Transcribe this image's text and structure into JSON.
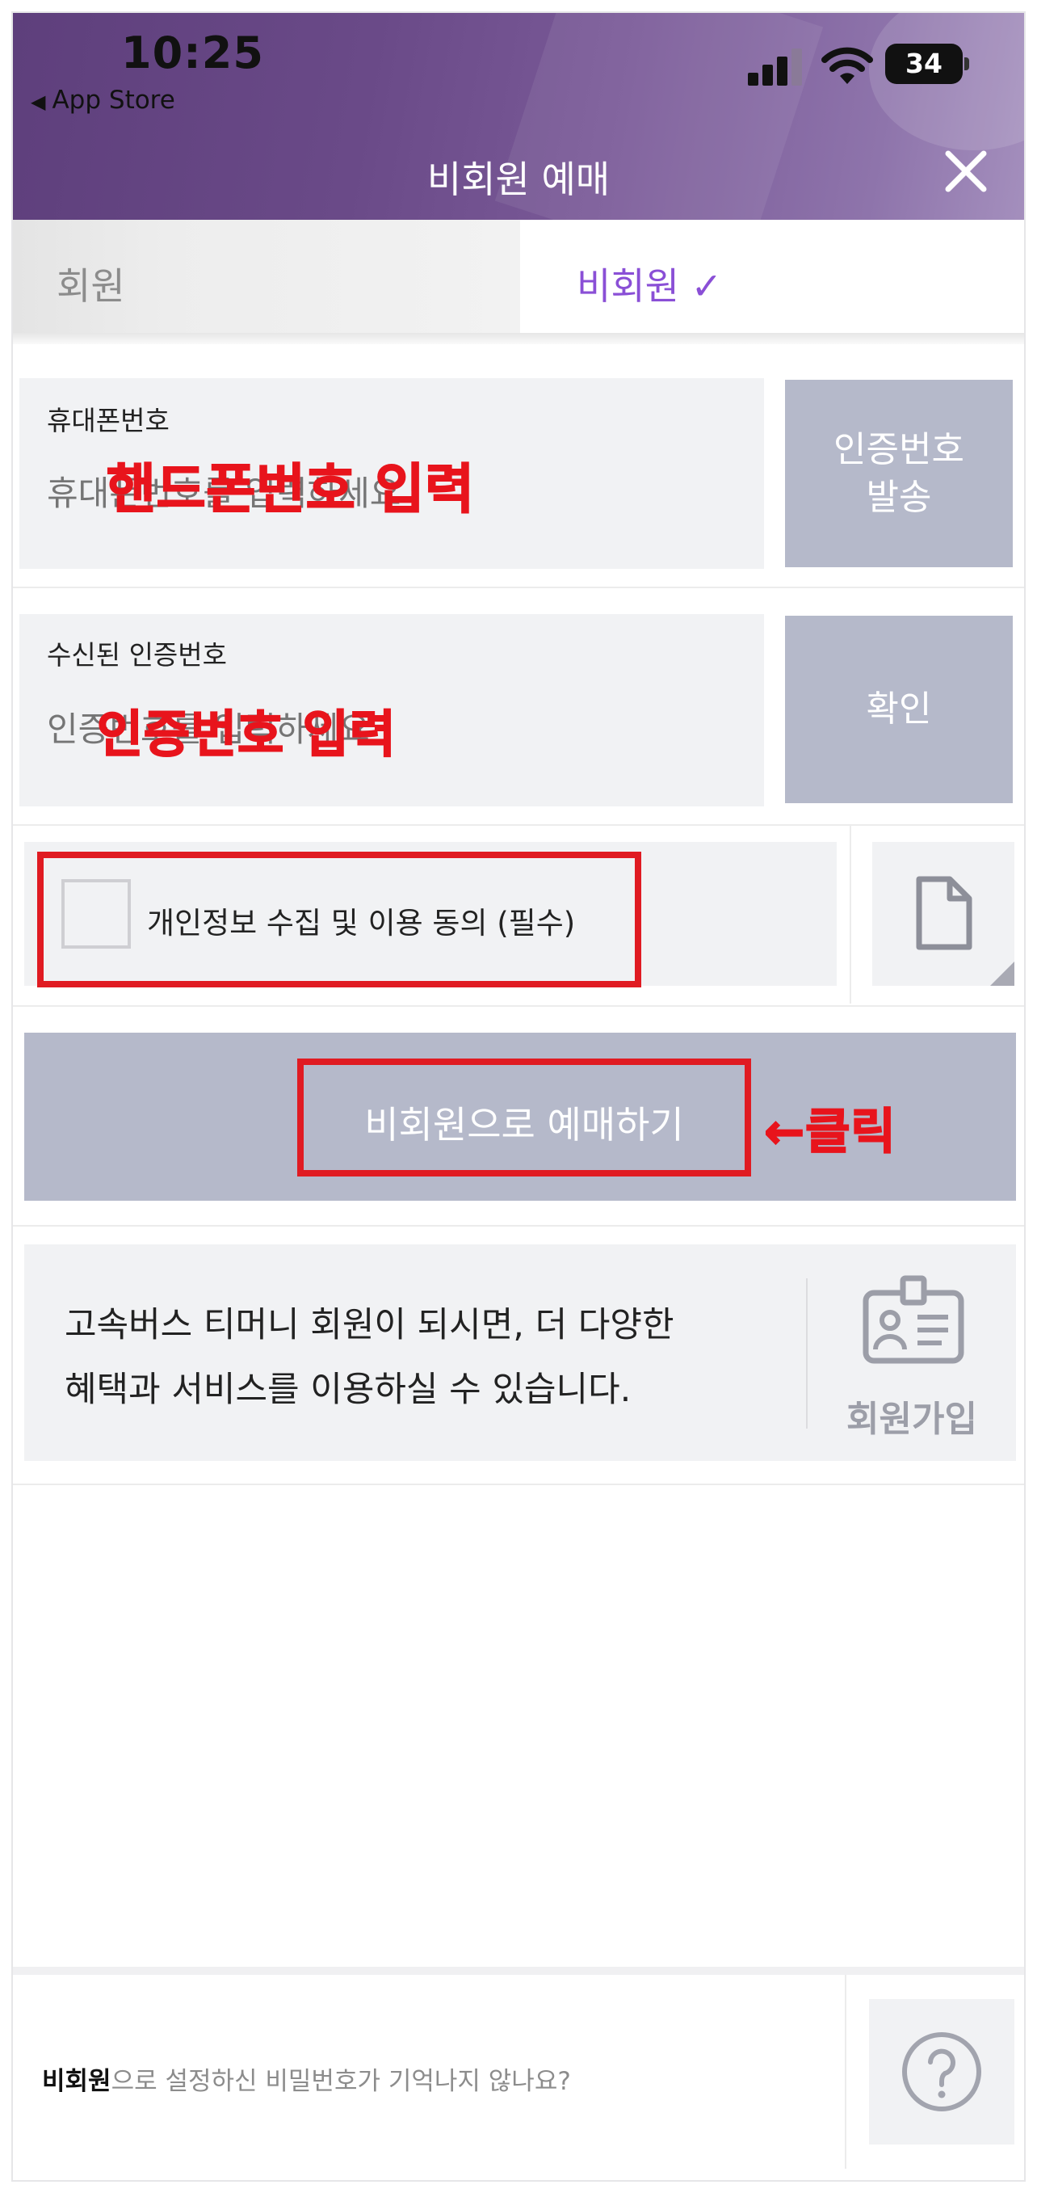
{
  "status_bar": {
    "time": "10:25",
    "back_label": "App Store",
    "battery": "34"
  },
  "header": {
    "title": "비회원 예매",
    "close_icon": "close-icon"
  },
  "tabs": {
    "member": "회원",
    "guest": "비회원 ✓"
  },
  "phone": {
    "label": "휴대폰번호",
    "placeholder": "휴대폰번호를 입력하세요",
    "annotation": "핸드폰번호 입력",
    "send_button": "인증번호\n발송"
  },
  "code": {
    "label": "수신된 인증번호",
    "placeholder": "인증번호를 입력하세요",
    "annotation": "인증번호 입력",
    "confirm_button": "확인"
  },
  "consent": {
    "label": "개인정보 수집 및 이용 동의 (필수)",
    "checked": false,
    "doc_icon": "document-icon"
  },
  "reserve": {
    "label": "비회원으로 예매하기",
    "annotation": "←클릭"
  },
  "signup": {
    "line1": "고속버스 티머니 회원이 되시면, 더 다양한",
    "line2": "혜택과 서비스를 이용하실 수 있습니다.",
    "button_label": "회원가입",
    "icon": "id-card-icon"
  },
  "footer": {
    "bold": "비회원",
    "text": "으로 설정하신 비밀번호가 기억나지 않나요?",
    "help_icon": "help-icon"
  },
  "colors": {
    "header_purple": "#6a4a88",
    "accent_purple": "#8a4fd6",
    "button_gray": "#b5b9ca",
    "annotation_red": "#e8141c"
  }
}
